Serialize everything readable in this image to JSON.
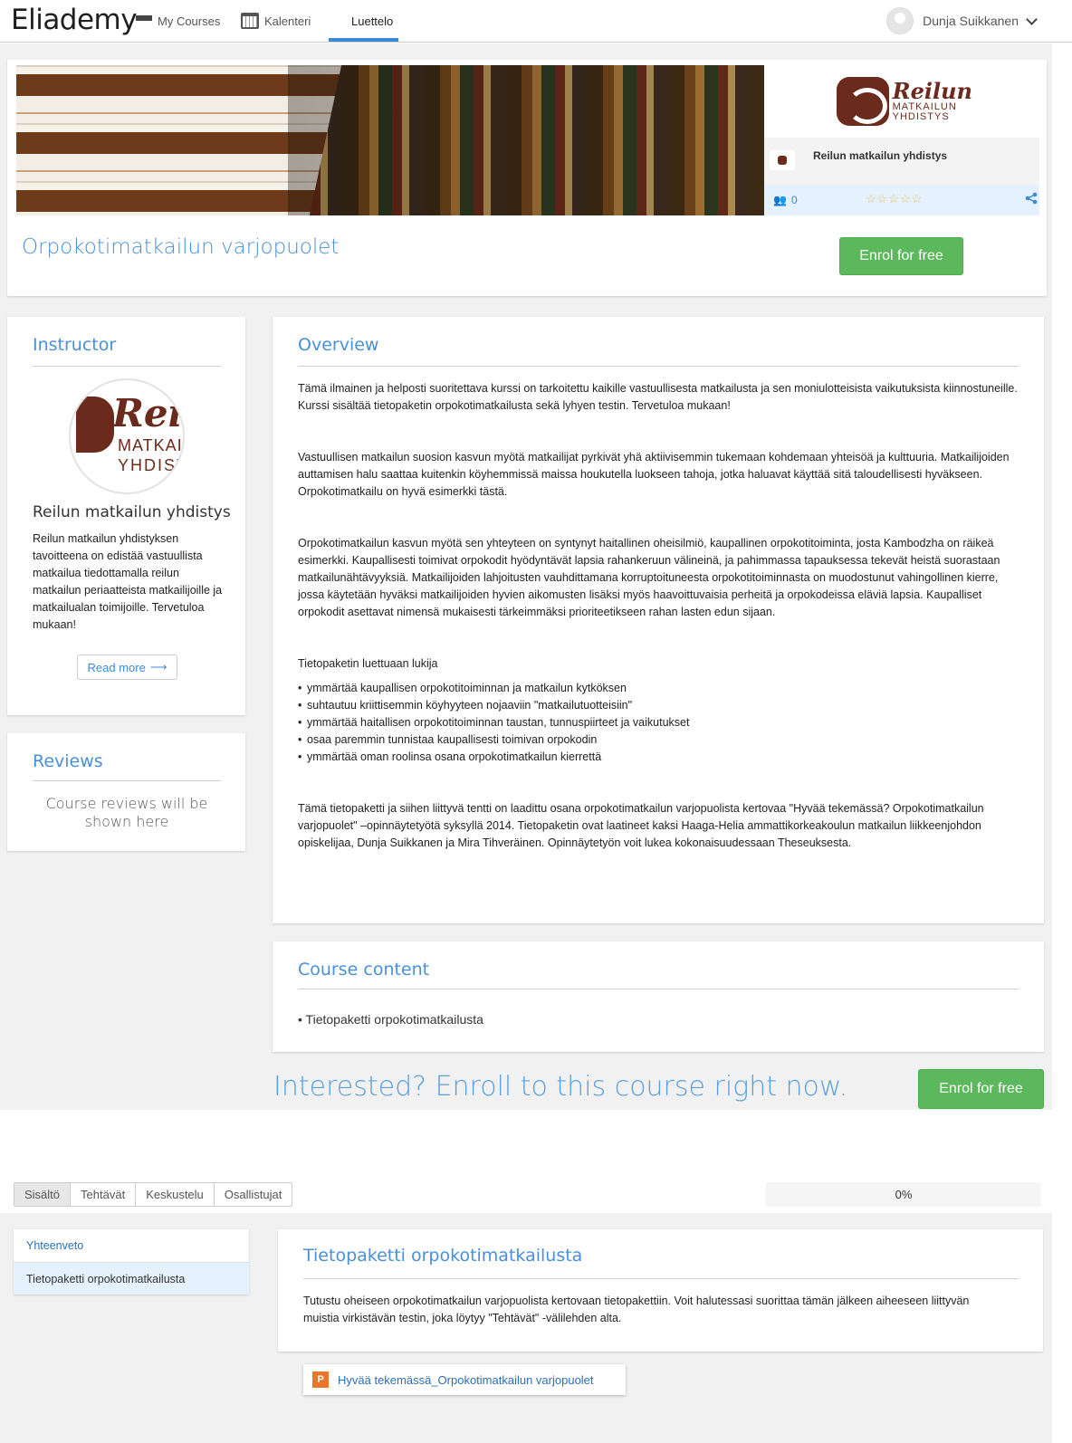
{
  "brand": "Eliademy",
  "nav": {
    "my_courses": "My Courses",
    "kalenteri": "Kalenteri",
    "luettelo": "Luettelo"
  },
  "user": {
    "name": "Dunja Suikkanen"
  },
  "hero": {
    "org_logo_line1": "Reilun",
    "org_logo_line2": "MATKAILUN",
    "org_logo_line3": "YHDISTYS",
    "org_name": "Reilun matkailun yhdistys",
    "participants": "0",
    "rating_stars": "☆☆☆☆☆",
    "course_title": "Orpokotimatkailun varjopuolet",
    "enrol_label": "Enrol for free"
  },
  "instructor": {
    "heading": "Instructor",
    "name": "Reilun matkailun yhdistys",
    "bio": "Reilun matkailun yhdistyksen tavoitteena on edistää vastuullista matkailua tiedottamalla reilun matkailun periaatteista matkailijoille ja matkailualan toimijoille. Tervetuloa mukaan!",
    "read_more": "Read more"
  },
  "reviews": {
    "heading": "Reviews",
    "empty_text": "Course reviews will be shown here"
  },
  "overview": {
    "heading": "Overview",
    "p1": "Tämä ilmainen ja helposti suoritettava kurssi on tarkoitettu kaikille vastuullisesta matkailusta ja sen moniulotteisista vaikutuksista kiinnostuneille. Kurssi sisältää tietopaketin orpokotimatkailusta sekä lyhyen testin. Tervetuloa mukaan!",
    "p2": "Vastuullisen matkailun suosion kasvun myötä matkailijat pyrkivät yhä aktiivisemmin tukemaan kohdemaan yhteisöä ja kulttuuria. Matkailijoiden auttamisen halu saattaa kuitenkin köyhemmissä maissa houkutella luokseen tahoja, jotka haluavat käyttää sitä taloudellisesti hyväkseen. Orpokotimatkailu on hyvä esimerkki tästä.",
    "p3": "Orpokotimatkailun kasvun myötä sen yhteyteen on syntynyt haitallinen oheisilmiö, kaupallinen orpokotitoiminta, josta Kambodzha on räikeä esimerkki. Kaupallisesti toimivat orpokodit hyödyntävät lapsia rahankeruun välineinä, ja pahimmassa tapauksessa tekevät heistä suorastaan matkailunähtävyyksiä. Matkailijoiden lahjoitusten vauhdittamana korruptoituneesta orpokotitoiminnasta on muodostunut vahingollinen kierre, jossa käytetään hyväksi matkailijoiden hyvien aikomusten lisäksi myös haavoittuvaisia perheitä ja orpokodeissa eläviä lapsia. Kaupalliset orpokodit asettavat nimensä mukaisesti tärkeimmäksi prioriteetikseen rahan lasten edun sijaan.",
    "p4": "Tietopaketin luettuaan lukija",
    "bullets": [
      "ymmärtää kaupallisen orpokotitoiminnan ja matkailun kytköksen",
      "suhtautuu kriittisemmin köyhyyteen nojaaviin \"matkailutuotteisiin\"",
      "ymmärtää haitallisen orpokotitoiminnan taustan, tunnuspiirteet ja vaikutukset",
      "osaa paremmin tunnistaa kaupallisesti toimivan orpokodin",
      "ymmärtää oman roolinsa osana orpokotimatkailun kierrettä"
    ],
    "p5": "Tämä tietopaketti ja siihen liittyvä tentti on laadittu osana orpokotimatkailun varjopuolista kertovaa \"Hyvää tekemässä? Orpokotimatkailun varjopuolet\" –opinnäytetyötä syksyllä 2014. Tietopaketin ovat laatineet kaksi Haaga-Helia ammattikorkeakoulun matkailun liikkeenjohdon opiskelijaa, Dunja Suikkanen ja Mira Tihveräinen. Opinnäytetyön voit lukea kokonaisuudessaan Theseuksesta."
  },
  "course_content": {
    "heading": "Course content",
    "items": [
      "Tietopaketti orpokotimatkailusta"
    ]
  },
  "cta": {
    "text": "Interested? Enroll to this course right now.",
    "enrol_label": "Enrol for free"
  },
  "tabs": [
    "Sisältö",
    "Tehtävät",
    "Keskustelu",
    "Osallistujat"
  ],
  "progress": "0%",
  "leftnav": [
    "Yhteenveto",
    "Tietopaketti orpokotimatkailusta"
  ],
  "topic": {
    "heading": "Tietopaketti orpokotimatkailusta",
    "text": "Tutustu oheiseen orpokotimatkailun varjopuolista kertovaan tietopakettiin. Voit halutessasi suorittaa tämän jälkeen aiheeseen liittyvän muistia virkistävän testin, joka löytyy \"Tehtävät\" -välilehden alta.",
    "resource_badge": "P",
    "resource": "Hyvää tekemässä_Orpokotimatkailun varjopuolet"
  },
  "colors": {
    "accent_blue": "#4a90d9",
    "green": "#5cb85c",
    "brand_brown": "#6b2b1c"
  }
}
